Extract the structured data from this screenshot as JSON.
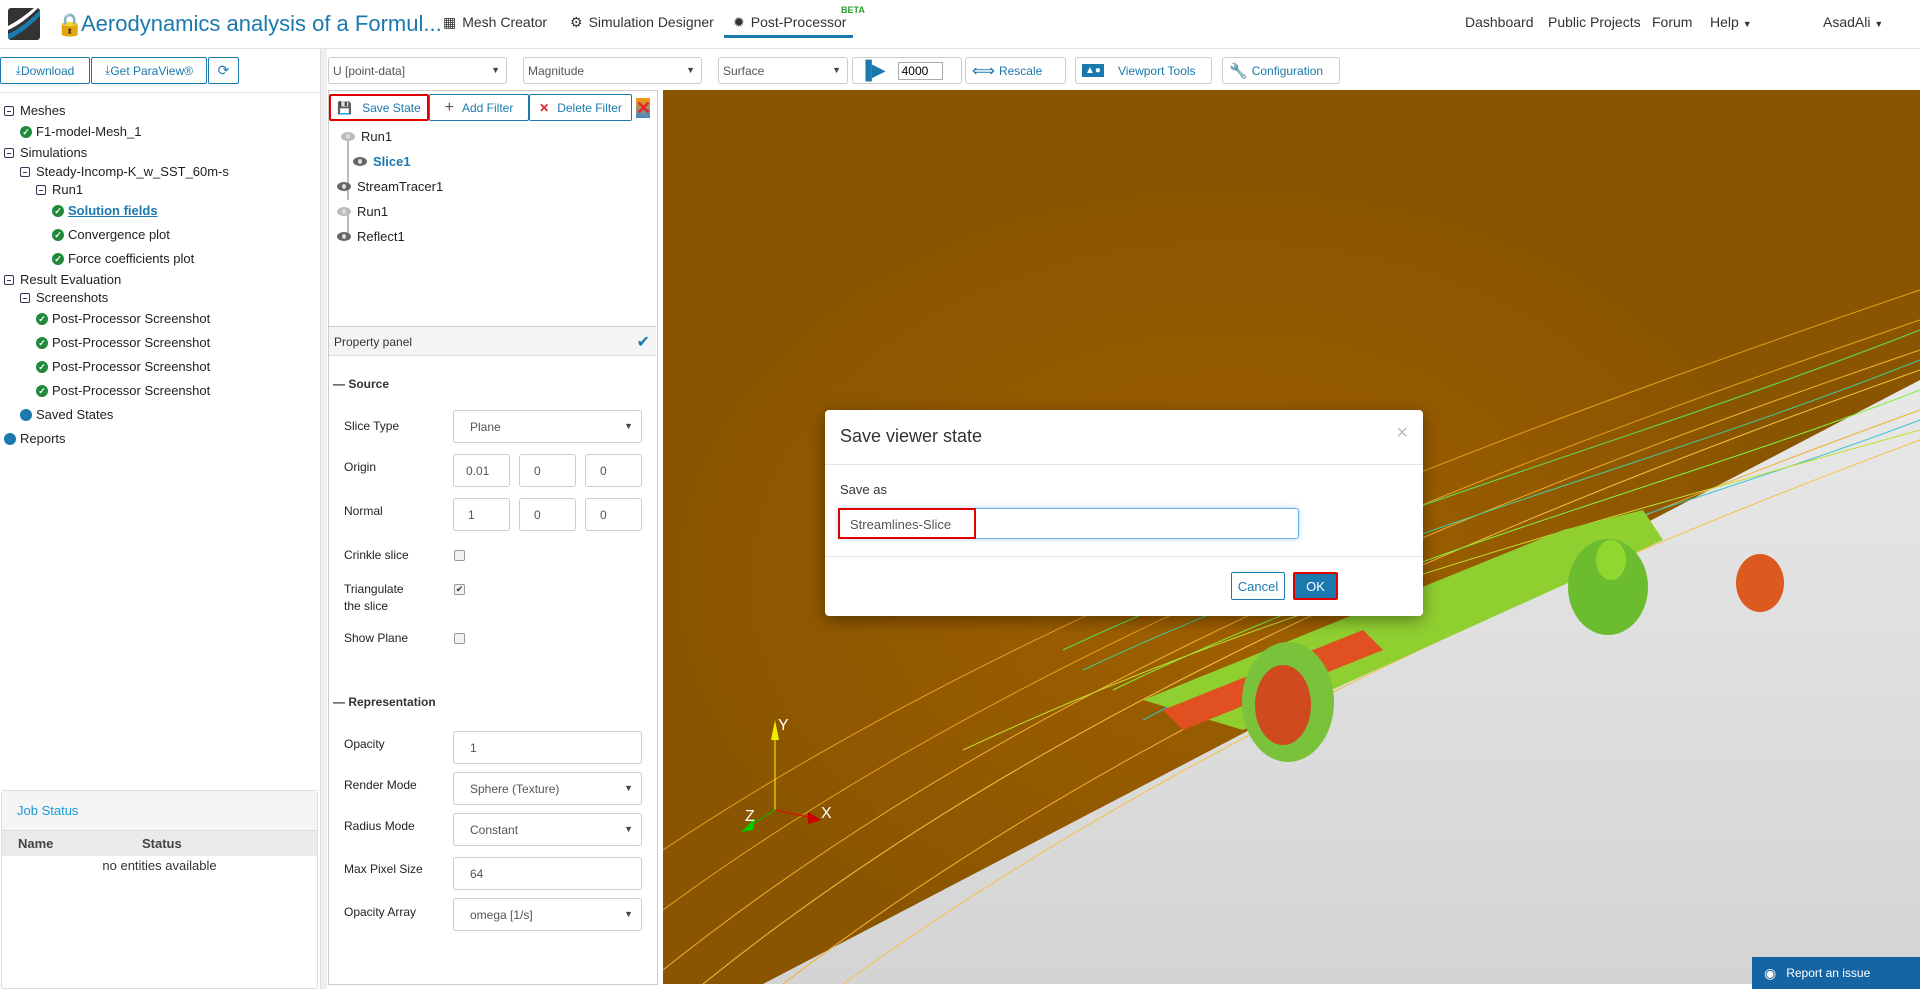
{
  "header": {
    "title": "Aerodynamics analysis of a Formul...",
    "nav": [
      {
        "label": "Mesh Creator",
        "icon": "grid-icon"
      },
      {
        "label": "Simulation Designer",
        "icon": "gears-icon"
      },
      {
        "label": "Post-Processor",
        "icon": "gear-icon",
        "badge": "BETA"
      }
    ],
    "right": [
      "Dashboard",
      "Public Projects",
      "Forum",
      "Help"
    ],
    "user": "AsadAli"
  },
  "sidebar": {
    "download": "Download",
    "paraview": "Get ParaView®",
    "tree": {
      "meshes": "Meshes",
      "mesh1": "F1-model-Mesh_1",
      "simulations": "Simulations",
      "sim1": "Steady-Incomp-K_w_SST_60m-s",
      "run1": "Run1",
      "solution": "Solution fields",
      "convergence": "Convergence plot",
      "force": "Force coefficients plot",
      "result": "Result Evaluation",
      "screenshots": "Screenshots",
      "shots": [
        "Post-Processor Screenshot",
        "Post-Processor Screenshot",
        "Post-Processor Screenshot",
        "Post-Processor Screenshot"
      ],
      "saved": "Saved States",
      "reports": "Reports"
    },
    "job": {
      "title": "Job Status",
      "col_name": "Name",
      "col_status": "Status",
      "empty": "no entities available"
    }
  },
  "toolbar": {
    "field": "U [point-data]",
    "component": "Magnitude",
    "representation": "Surface",
    "timestep": "4000",
    "rescale": "Rescale",
    "viewport": "Viewport Tools",
    "config": "Configuration"
  },
  "pipeline": {
    "save": "Save State",
    "add": "Add Filter",
    "delete": "Delete Filter",
    "items": [
      "Run1",
      "Slice1",
      "StreamTracer1",
      "Run1",
      "Reflect1"
    ]
  },
  "props": {
    "title": "Property panel",
    "source": "Source",
    "slice_type_l": "Slice Type",
    "slice_type": "Plane",
    "origin_l": "Origin",
    "origin": [
      "0.01",
      "0",
      "0"
    ],
    "normal_l": "Normal",
    "normal": [
      "1",
      "0",
      "0"
    ],
    "crinkle_l": "Crinkle slice",
    "crinkle": false,
    "tri_l1": "Triangulate",
    "tri_l2": "the slice",
    "tri": true,
    "showplane_l": "Show Plane",
    "showplane": false,
    "repr": "Representation",
    "opacity_l": "Opacity",
    "opacity": "1",
    "render_l": "Render Mode",
    "render": "Sphere (Texture)",
    "radius_l": "Radius Mode",
    "radius": "Constant",
    "maxpx_l": "Max Pixel Size",
    "maxpx": "64",
    "oparr_l": "Opacity Array",
    "oparr": "omega [1/s]"
  },
  "viewport": {
    "axes": {
      "x": "X",
      "y": "Y",
      "z": "Z"
    },
    "report": "Report an issue"
  },
  "dialog": {
    "title": "Save viewer state",
    "label": "Save as",
    "value": "Streamlines-Slice",
    "cancel": "Cancel",
    "ok": "OK"
  },
  "colors": {
    "accent": "#1a7aad",
    "highlight": "#e00000",
    "success": "#1e8a3a"
  }
}
